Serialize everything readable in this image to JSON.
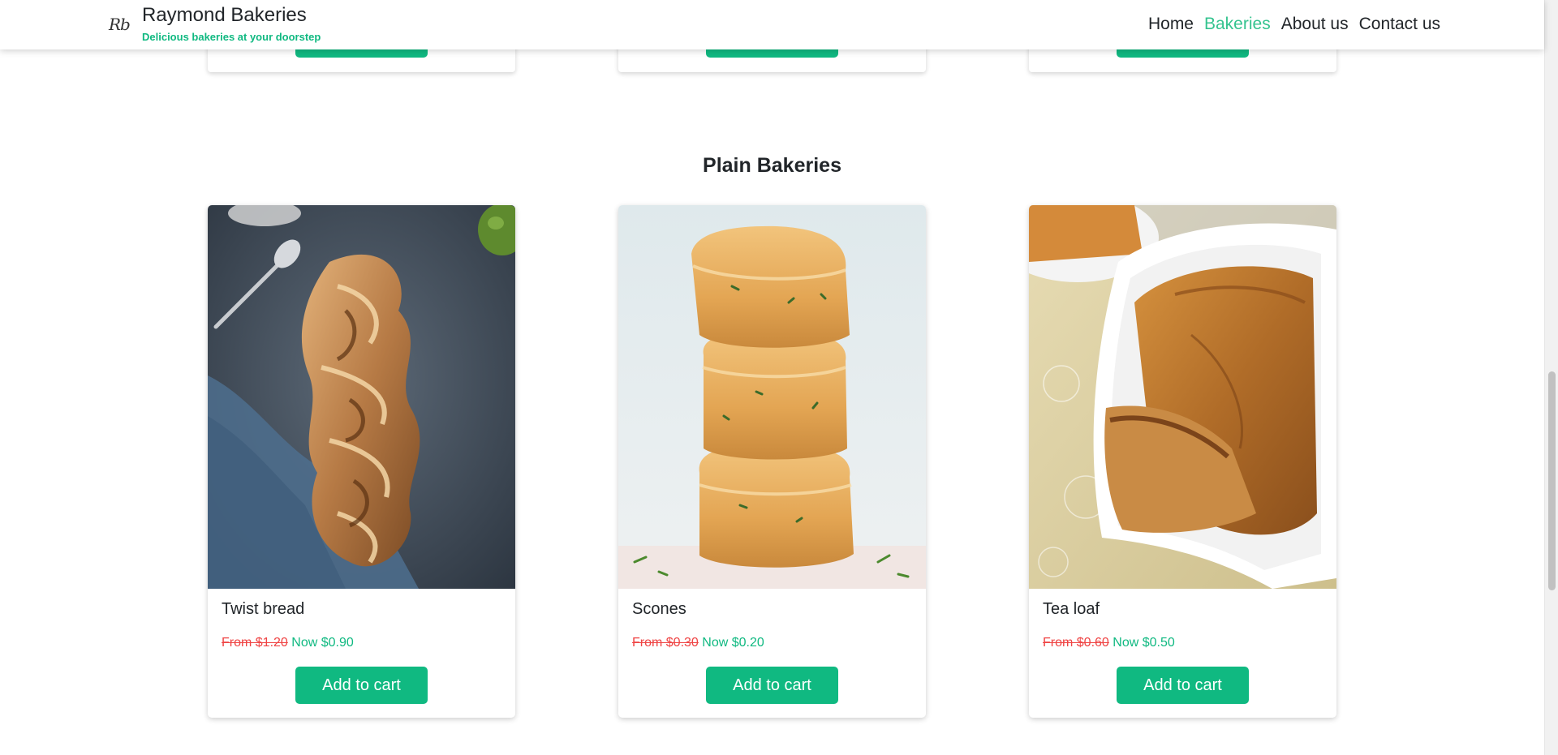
{
  "brand": {
    "logo": "Rb",
    "name": "Raymond Bakeries",
    "tagline": "Delicious bakeries at your doorstep"
  },
  "nav": [
    {
      "label": "Home",
      "active": false
    },
    {
      "label": "Bakeries",
      "active": true
    },
    {
      "label": "About us",
      "active": false
    },
    {
      "label": "Contact us",
      "active": false
    }
  ],
  "section": {
    "title": "Plain Bakeries"
  },
  "products": [
    {
      "name": "Twist bread",
      "old_price": "From $1.20",
      "new_price": "Now $0.90",
      "button": "Add to cart",
      "image_icon": "twist-bread-image"
    },
    {
      "name": "Scones",
      "old_price": "From $0.30",
      "new_price": "Now $0.20",
      "button": "Add to cart",
      "image_icon": "scones-image"
    },
    {
      "name": "Tea loaf",
      "old_price": "From $0.60",
      "new_price": "Now $0.50",
      "button": "Add to cart",
      "image_icon": "tea-loaf-image"
    }
  ],
  "colors": {
    "accent": "#10b981",
    "nav_active": "#34c38f",
    "old_price": "#ef4444",
    "text": "#212529"
  }
}
